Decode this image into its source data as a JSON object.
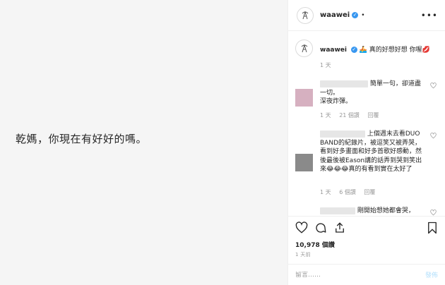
{
  "media": {
    "text": "乾媽，你現在有好好的嗎。"
  },
  "header": {
    "username": "waawei",
    "separator": "•",
    "more_label": "•••"
  },
  "caption": {
    "username": "waawei",
    "text": "🚣 真的好想好想 你喔💋",
    "time": "1 天"
  },
  "comments": [
    {
      "avatar_color": "#d6b0c0",
      "text": "簡單一句，卻道盡一切。\n深夜炸彈。",
      "time": "1 天",
      "likes": "21 個讚",
      "reply": "回覆"
    },
    {
      "avatar_color": "#8a8a8a",
      "text": "上個週末去看DUO BAND的紀錄片，被逗笑又被弄哭，看到好多畫面和好多首歌好感動，然後最後被Eason講的話弄到哭到笑出來😂😂😂真的有看到實在太好了",
      "time": "1 天",
      "likes": "6 個讚",
      "reply": "回覆"
    },
    {
      "avatar_color": "#c8c8c8",
      "text": "剛開始想她都會哭，",
      "time": "",
      "likes": "",
      "reply": ""
    }
  ],
  "likes": "10,978 個讚",
  "post_time": "1 天前",
  "add_comment": {
    "placeholder": "留言……",
    "post_label": "發佈"
  },
  "colors": {
    "accent": "#3897f0",
    "muted": "#999999",
    "post_disabled": "#b2dffc"
  },
  "icons": [
    "heart-icon",
    "comment-icon",
    "share-icon",
    "bookmark-icon",
    "verified-badge-icon",
    "more-options-icon"
  ]
}
